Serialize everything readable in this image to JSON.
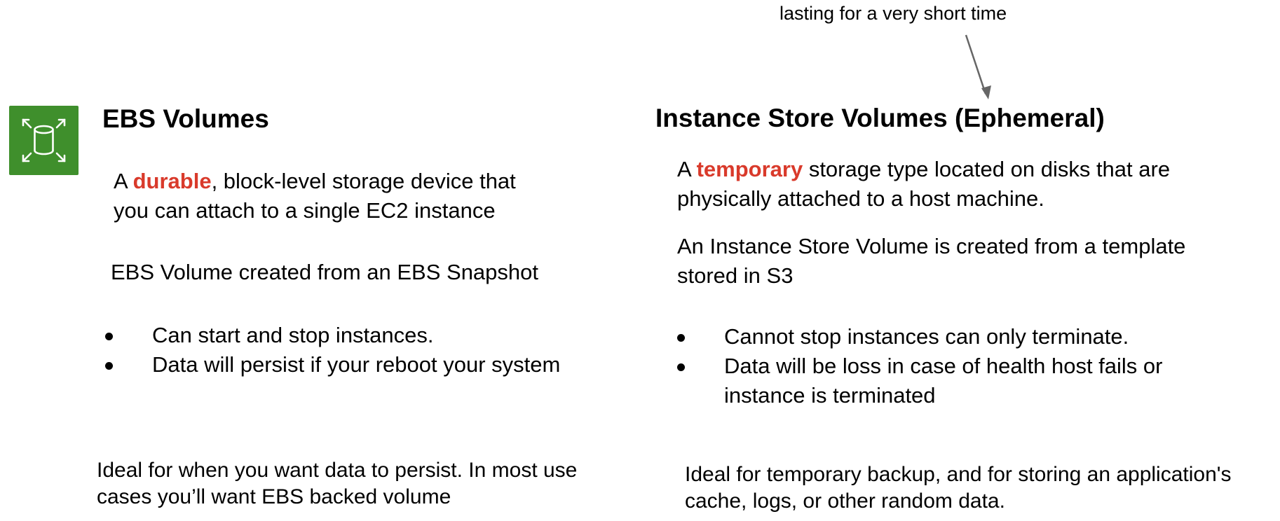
{
  "annotation": {
    "text": "lasting for a very short time"
  },
  "ebs": {
    "icon": "ebs-volume-icon",
    "title": "EBS Volumes",
    "desc_pre": "A ",
    "desc_highlight": "durable",
    "desc_line1_post": ", block-level storage device that",
    "desc_line2": "you can attach to a single EC2 instance",
    "snapshot": "EBS Volume created from an EBS Snapshot",
    "bullets": [
      "Can start and stop instances.",
      "Data will persist if your reboot your system"
    ],
    "ideal_line1": "Ideal for when you want data to persist. In most use",
    "ideal_line2": "cases you’ll want EBS backed volume"
  },
  "instance_store": {
    "title": "Instance Store Volumes (Ephemeral)",
    "desc_pre": "A ",
    "desc_highlight": "temporary",
    "desc_line1_post": " storage type located on disks that are",
    "desc_line2": "physically attached to a host machine.",
    "template_line1": "An Instance Store Volume is created from a template",
    "template_line2": "stored in S3",
    "bullets": [
      "Cannot stop instances can only terminate.",
      "Data will be loss in case of health host fails or",
      "instance is terminated"
    ],
    "ideal_line1": "Ideal for temporary backup, and for storing an application's",
    "ideal_line2": "cache, logs, or other random data."
  },
  "colors": {
    "highlight": "#d93a2b",
    "icon_bg": "#3f8f2c",
    "arrow": "#666666"
  }
}
